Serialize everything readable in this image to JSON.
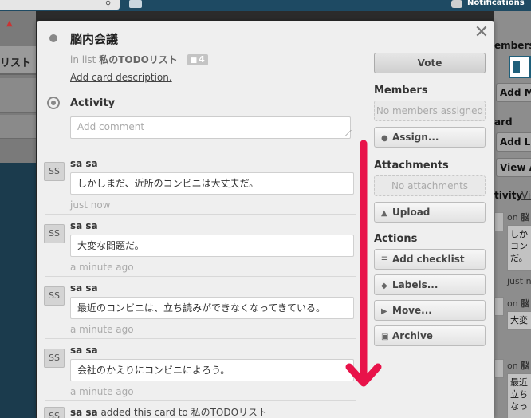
{
  "topbar": {
    "notifications_label": "Notifications"
  },
  "background": {
    "left_header": "リスト",
    "right": {
      "members": "embers",
      "add_members": "Add Mem",
      "card": "ard",
      "add_list": "Add Lis",
      "view_all": "View Al",
      "activity": "tivity",
      "view": "Vie",
      "items": [
        {
          "on": "on",
          "card_name": "脳",
          "text": "しか\nコン\nだ。",
          "time": "just no"
        },
        {
          "on": "on",
          "card_name": "脳",
          "text": "大変",
          "time": ""
        },
        {
          "on": "on",
          "card_name": "脳",
          "text": "最近\n立ち\nなっ",
          "time": ""
        }
      ]
    }
  },
  "card": {
    "title": "脳内会議",
    "in_list_prefix": "in list",
    "list_name": "私のTODOリスト",
    "comment_count": "4",
    "add_description": "Add card description."
  },
  "activity": {
    "title": "Activity",
    "comment_placeholder": "Add comment",
    "entries": [
      {
        "initials": "SS",
        "author": "sa sa",
        "text": "しかしまだ、近所のコンビニは大丈夫だ。",
        "time": "just now"
      },
      {
        "initials": "SS",
        "author": "sa sa",
        "text": "大変な問題だ。",
        "time": "a minute ago"
      },
      {
        "initials": "SS",
        "author": "sa sa",
        "text": "最近のコンビニは、立ち読みができなくなってきている。",
        "time": "a minute ago"
      },
      {
        "initials": "SS",
        "author": "sa sa",
        "text": "会社のかえりにコンビニによろう。",
        "time": "a minute ago"
      }
    ],
    "last_entry": {
      "initials": "SS",
      "author": "sa sa",
      "action": "added this card to",
      "list_name": "私のTODOリスト"
    }
  },
  "sidebar": {
    "vote_label": "Vote",
    "members_heading": "Members",
    "no_members": "No members assigned",
    "assign_label": "Assign...",
    "attachments_heading": "Attachments",
    "no_attachments": "No attachments",
    "upload_label": "Upload",
    "actions_heading": "Actions",
    "add_checklist_label": "Add checklist",
    "labels_label": "Labels...",
    "move_label": "Move...",
    "archive_label": "Archive"
  },
  "colors": {
    "annotation_arrow": "#e8134a"
  }
}
